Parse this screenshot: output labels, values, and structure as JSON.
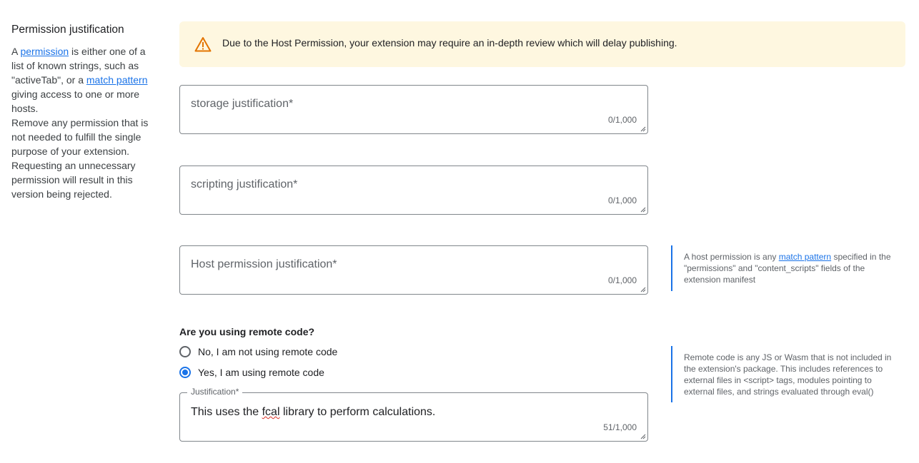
{
  "sidebar": {
    "title": "Permission justification",
    "p1_a": "A ",
    "p1_link": "permission",
    "p1_b": " is either one of a list of known strings, such as \"activeTab\", or a ",
    "p1_link2": "match pattern",
    "p1_c": " giving access to one or more hosts.",
    "p2": "Remove any permission that is not needed to fulfill the single purpose of your extension. Requesting an unnecessary permission will result in this version being rejected."
  },
  "banner": {
    "icon": "warning-icon",
    "message": "Due to the Host Permission, your extension may require an in-depth review which will delay publishing."
  },
  "fields": [
    {
      "placeholder": "storage justification*",
      "count": "0/1,000"
    },
    {
      "placeholder": "scripting justification*",
      "count": "0/1,000"
    },
    {
      "placeholder": "Host permission justification*",
      "count": "0/1,000"
    }
  ],
  "host_note": {
    "a": "A host permission is any ",
    "link": "match pattern",
    "b": " specified in the \"permissions\" and \"content_scripts\" fields of the extension manifest"
  },
  "remote": {
    "question": "Are you using remote code?",
    "option_no": "No, I am not using remote code",
    "option_yes": "Yes, I am using remote code",
    "selected": "yes",
    "justification_label": "Justification*",
    "justification_pre": "This uses the ",
    "justification_word": "fcal",
    "justification_post": " library to perform calculations.",
    "count": "51/1,000",
    "note": "Remote code is any JS or Wasm that is not included in the extension's package. This includes references to external files in <script> tags, modules pointing to external files, and strings evaluated through eval()"
  },
  "colors": {
    "accent": "#1a73e8",
    "warning_bg": "#fef7e0",
    "warning_icon": "#e37400"
  }
}
